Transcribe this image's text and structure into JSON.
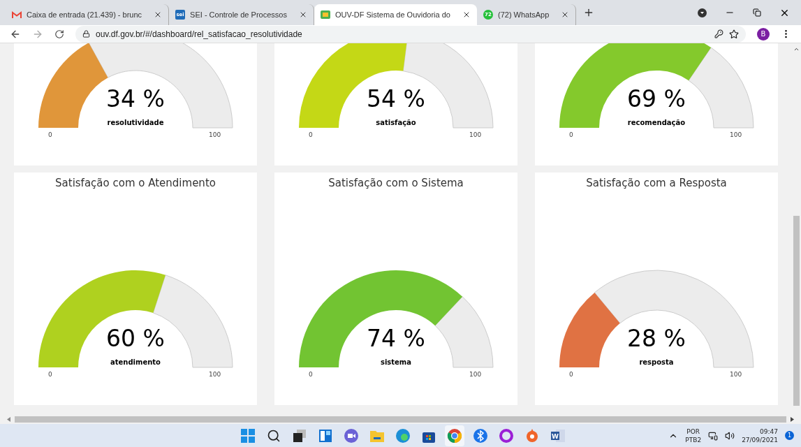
{
  "browser": {
    "tabs": [
      {
        "title": "Caixa de entrada (21.439) - brunc",
        "kind": "mail",
        "selected": false
      },
      {
        "title": "SEI - Controle de Processos",
        "kind": "sei",
        "selected": false
      },
      {
        "title": "OUV-DF Sistema de Ouvidoria do",
        "kind": "ouv",
        "selected": true
      },
      {
        "title": "(72) WhatsApp",
        "kind": "chat",
        "selected": false
      }
    ],
    "favicon_texts": {
      "sei": "sei",
      "chat": "72"
    },
    "url": "ouv.df.gov.br/#/dashboard/rel_satisfacao_resolutividade",
    "avatar": "B"
  },
  "gauges": [
    {
      "value": "34 %",
      "label": "resolutividade",
      "min": "0",
      "max": "100",
      "color": "#e0963a"
    },
    {
      "value": "54 %",
      "label": "satisfação",
      "min": "0",
      "max": "100",
      "color": "#c4d816"
    },
    {
      "value": "69 %",
      "label": "recomendação",
      "min": "0",
      "max": "100",
      "color": "#84c92c"
    },
    {
      "title": "Satisfação com o Atendimento",
      "value": "60 %",
      "label": "atendimento",
      "min": "0",
      "max": "100",
      "color": "#afd11f"
    },
    {
      "title": "Satisfação com o Sistema",
      "value": "74 %",
      "label": "sistema",
      "min": "0",
      "max": "100",
      "color": "#72c432"
    },
    {
      "title": "Satisfação com a Resposta",
      "value": "28 %",
      "label": "resposta",
      "min": "0",
      "max": "100",
      "color": "#e07243"
    }
  ],
  "taskbar": {
    "apps": [
      {
        "kind": "start",
        "selected": false
      },
      {
        "kind": "search",
        "selected": false
      },
      {
        "kind": "taskview",
        "selected": false
      },
      {
        "kind": "widgets",
        "selected": false
      },
      {
        "kind": "meet",
        "selected": false
      },
      {
        "kind": "folder",
        "selected": false
      },
      {
        "kind": "edge",
        "selected": false
      },
      {
        "kind": "store",
        "selected": false
      },
      {
        "kind": "chrome",
        "selected": true
      },
      {
        "kind": "bluetooth",
        "selected": false
      },
      {
        "kind": "ring",
        "selected": false
      },
      {
        "kind": "origin",
        "selected": false
      },
      {
        "kind": "word",
        "selected": false
      }
    ],
    "language": "POR",
    "layout": "PTB2",
    "time": "09:47",
    "date": "27/09/2021",
    "notifications": "1",
    "word_letter": "W"
  }
}
